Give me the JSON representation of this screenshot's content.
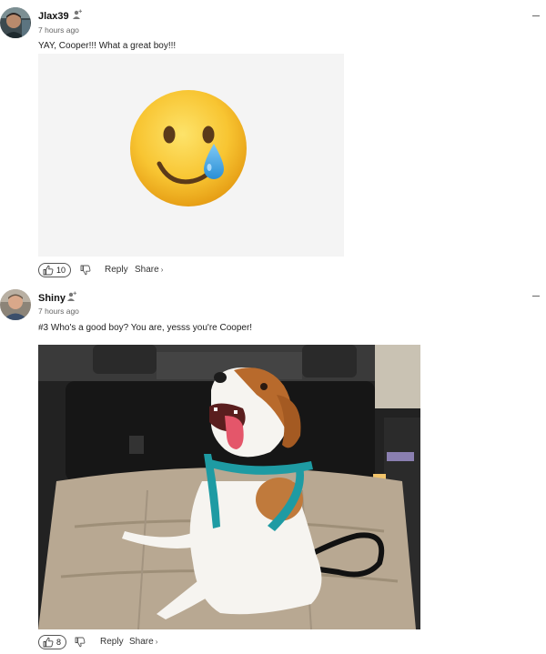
{
  "comments": [
    {
      "username": "Jlax39",
      "timestamp": "7 hours ago",
      "text": "YAY, Cooper!!! What a great boy!!!",
      "media": "crying-smile-emoji",
      "like_count": "10",
      "reply_label": "Reply",
      "share_label": "Share",
      "share_chevron": "›"
    },
    {
      "username": "Shiny",
      "timestamp": "7 hours ago",
      "text": "#3 Who's a good boy? You are, yesss you're Cooper!",
      "media": "dog-photo",
      "like_count": "8",
      "reply_label": "Reply",
      "share_label": "Share",
      "share_chevron": "›"
    }
  ],
  "colors": {
    "emoji_face": "#f6c12f",
    "emoji_tear": "#3da3e3",
    "media_bg": "#f4f4f4",
    "icon_gray": "#666666"
  }
}
